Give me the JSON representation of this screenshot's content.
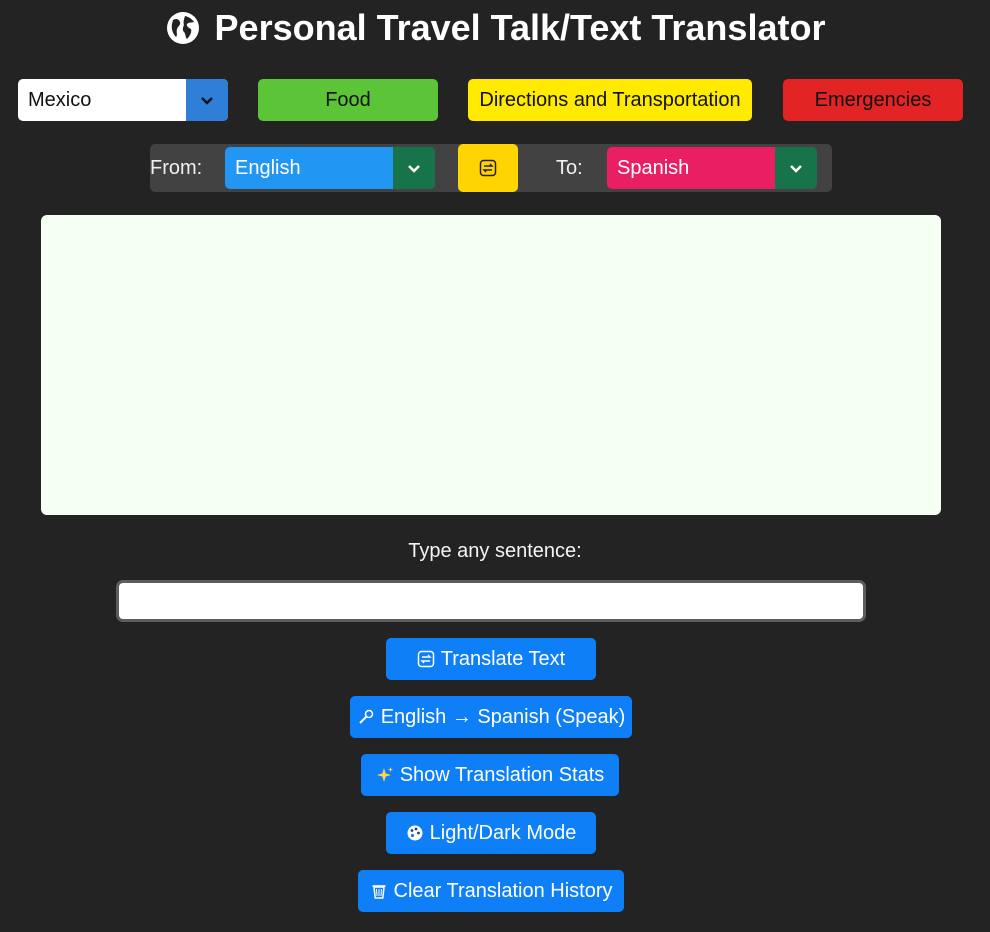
{
  "header": {
    "title": "Personal Travel Talk/Text Translator",
    "icon": "globe-icon"
  },
  "country": {
    "selected": "Mexico"
  },
  "categories": [
    {
      "label": "Food",
      "color": "#5cc437"
    },
    {
      "label": "Directions and Transportation",
      "color": "#ffea00"
    },
    {
      "label": "Emergencies",
      "color": "#e22424"
    }
  ],
  "languages": {
    "from_label": "From:",
    "from_selected": "English",
    "to_label": "To:",
    "to_selected": "Spanish",
    "swap_icon": "swap-icon"
  },
  "input": {
    "prompt": "Type any sentence:",
    "value": "",
    "placeholder": ""
  },
  "actions": {
    "translate": "Translate Text",
    "speak": "English → Spanish (Speak)",
    "stats": "Show Translation Stats",
    "mode": "Light/Dark Mode",
    "clear": "Clear Translation History"
  },
  "colors": {
    "background": "#232323",
    "action_button": "#0f7ff7",
    "output_box": "#f6fff4",
    "from_select": "#2196f3",
    "to_select": "#e91e63",
    "swap_button": "#ffd400"
  }
}
